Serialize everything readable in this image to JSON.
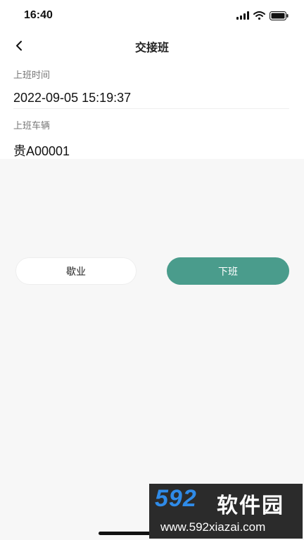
{
  "status_bar": {
    "time": "16:40"
  },
  "nav": {
    "title": "交接班"
  },
  "fields": {
    "shift_start_label": "上班时间",
    "shift_start_value": "2022-09-05 15:19:37",
    "vehicle_label": "上班车辆",
    "vehicle_value": "贵A00001"
  },
  "actions": {
    "rest_label": "歇业",
    "off_label": "下班"
  },
  "colors": {
    "accent": "#4a9c8c",
    "page_bg": "#f7f7f7"
  },
  "watermark": {
    "logo": "592",
    "name": "软件园",
    "url": "www.592xiazai.com"
  },
  "icons": [
    "back-arrow-icon",
    "signal-icon",
    "wifi-icon",
    "battery-icon"
  ]
}
